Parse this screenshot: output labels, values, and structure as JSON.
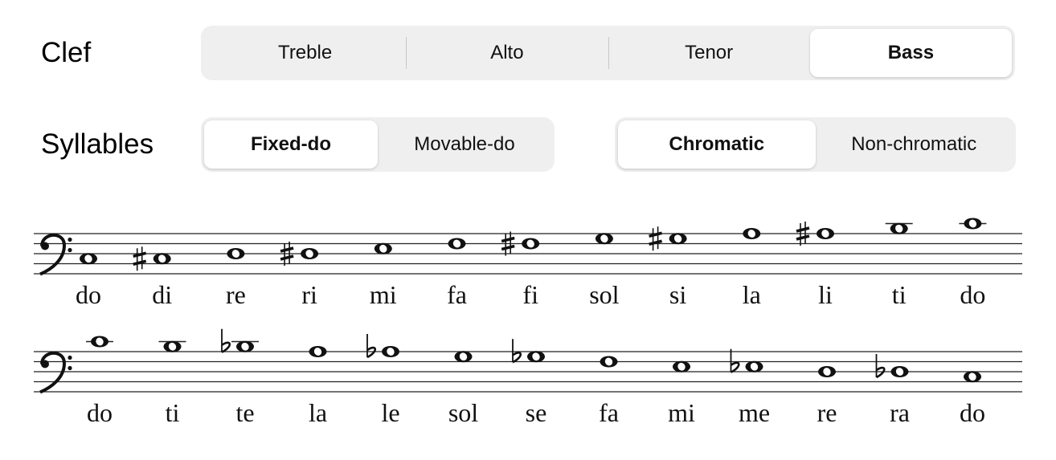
{
  "clef": {
    "label": "Clef",
    "options": [
      "Treble",
      "Alto",
      "Tenor",
      "Bass"
    ],
    "selected": "Bass"
  },
  "syllables": {
    "label": "Syllables",
    "mode_options": [
      "Fixed-do",
      "Movable-do"
    ],
    "mode_selected": "Fixed-do",
    "scale_options": [
      "Chromatic",
      "Non-chromatic"
    ],
    "scale_selected": "Chromatic"
  },
  "ascending": {
    "notes": [
      {
        "syllable": "do",
        "pitch": "C3",
        "accidental": ""
      },
      {
        "syllable": "di",
        "pitch": "C#3",
        "accidental": "sharp"
      },
      {
        "syllable": "re",
        "pitch": "D3",
        "accidental": ""
      },
      {
        "syllable": "ri",
        "pitch": "D#3",
        "accidental": "sharp"
      },
      {
        "syllable": "mi",
        "pitch": "E3",
        "accidental": ""
      },
      {
        "syllable": "fa",
        "pitch": "F3",
        "accidental": ""
      },
      {
        "syllable": "fi",
        "pitch": "F#3",
        "accidental": "sharp"
      },
      {
        "syllable": "sol",
        "pitch": "G3",
        "accidental": ""
      },
      {
        "syllable": "si",
        "pitch": "G#3",
        "accidental": "sharp"
      },
      {
        "syllable": "la",
        "pitch": "A3",
        "accidental": ""
      },
      {
        "syllable": "li",
        "pitch": "A#3",
        "accidental": "sharp"
      },
      {
        "syllable": "ti",
        "pitch": "B3",
        "accidental": ""
      },
      {
        "syllable": "do",
        "pitch": "C4",
        "accidental": ""
      }
    ]
  },
  "descending": {
    "notes": [
      {
        "syllable": "do",
        "pitch": "C4",
        "accidental": ""
      },
      {
        "syllable": "ti",
        "pitch": "B3",
        "accidental": ""
      },
      {
        "syllable": "te",
        "pitch": "Bb3",
        "accidental": "flat"
      },
      {
        "syllable": "la",
        "pitch": "A3",
        "accidental": ""
      },
      {
        "syllable": "le",
        "pitch": "Ab3",
        "accidental": "flat"
      },
      {
        "syllable": "sol",
        "pitch": "G3",
        "accidental": ""
      },
      {
        "syllable": "se",
        "pitch": "Gb3",
        "accidental": "flat"
      },
      {
        "syllable": "fa",
        "pitch": "F3",
        "accidental": ""
      },
      {
        "syllable": "mi",
        "pitch": "E3",
        "accidental": ""
      },
      {
        "syllable": "me",
        "pitch": "Eb3",
        "accidental": "flat"
      },
      {
        "syllable": "re",
        "pitch": "D3",
        "accidental": ""
      },
      {
        "syllable": "ra",
        "pitch": "Db3",
        "accidental": "flat"
      },
      {
        "syllable": "do",
        "pitch": "C3",
        "accidental": ""
      }
    ]
  }
}
